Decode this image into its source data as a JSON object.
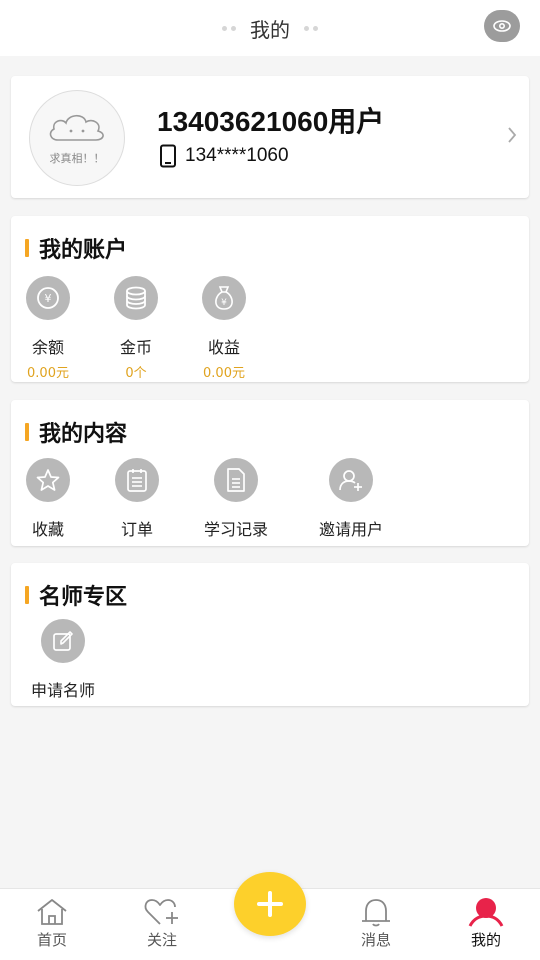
{
  "header": {
    "title": "我的",
    "settings_icon": "eye-settings-icon"
  },
  "profile": {
    "avatar_text": "求真相！！",
    "name": "13403621060用户",
    "phone": "134****1060"
  },
  "account": {
    "title": "我的账户",
    "items": [
      {
        "label": "余额",
        "value": "0.00元",
        "icon": "yen-coin-icon"
      },
      {
        "label": "金币",
        "value": "0个",
        "icon": "coin-stack-icon"
      },
      {
        "label": "收益",
        "value": "0.00元",
        "icon": "money-bag-icon"
      }
    ]
  },
  "content": {
    "title": "我的内容",
    "items": [
      {
        "label": "收藏",
        "icon": "star-icon"
      },
      {
        "label": "订单",
        "icon": "order-list-icon"
      },
      {
        "label": "学习记录",
        "icon": "document-icon"
      },
      {
        "label": "邀请用户",
        "icon": "add-user-icon"
      }
    ]
  },
  "teacher": {
    "title": "名师专区",
    "items": [
      {
        "label": "申请名师",
        "icon": "edit-icon"
      }
    ]
  },
  "nav": {
    "items": [
      {
        "label": "首页",
        "icon": "home-icon"
      },
      {
        "label": "关注",
        "icon": "heart-plus-icon"
      },
      {
        "label": "消息",
        "icon": "bell-icon"
      },
      {
        "label": "我的",
        "icon": "user-icon"
      }
    ],
    "active_index": 3,
    "fab_icon": "plus-icon"
  },
  "colors": {
    "accent": "#f5a623",
    "value_text": "#e0a31f",
    "fab": "#fdd02b",
    "active_user": "#e8234a",
    "icon_circle": "#b8b8b8"
  }
}
